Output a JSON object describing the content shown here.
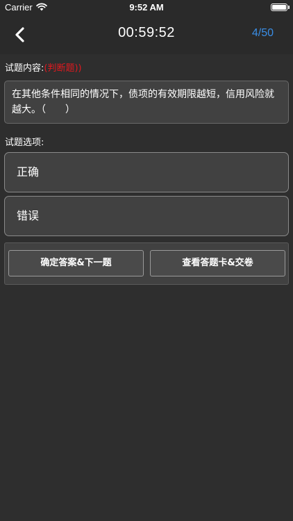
{
  "status_bar": {
    "carrier": "Carrier",
    "time": "9:52 AM"
  },
  "nav": {
    "back_icon": "chevron-left-icon",
    "timer": "00:59:52",
    "progress": "4/50",
    "progress_color": "#3a8ee6"
  },
  "question": {
    "label": "试题内容:",
    "type": "(判断题))",
    "type_color": "#e0191f",
    "text": "在其他条件相同的情况下，债项的有效期限越短，信用风险就越大。（　　）"
  },
  "options": {
    "label": "试题选项:",
    "items": [
      {
        "text": "正确"
      },
      {
        "text": "错误"
      }
    ]
  },
  "actions": {
    "confirm_label": "确定答案&下一题",
    "submit_label": "查看答题卡&交卷"
  }
}
